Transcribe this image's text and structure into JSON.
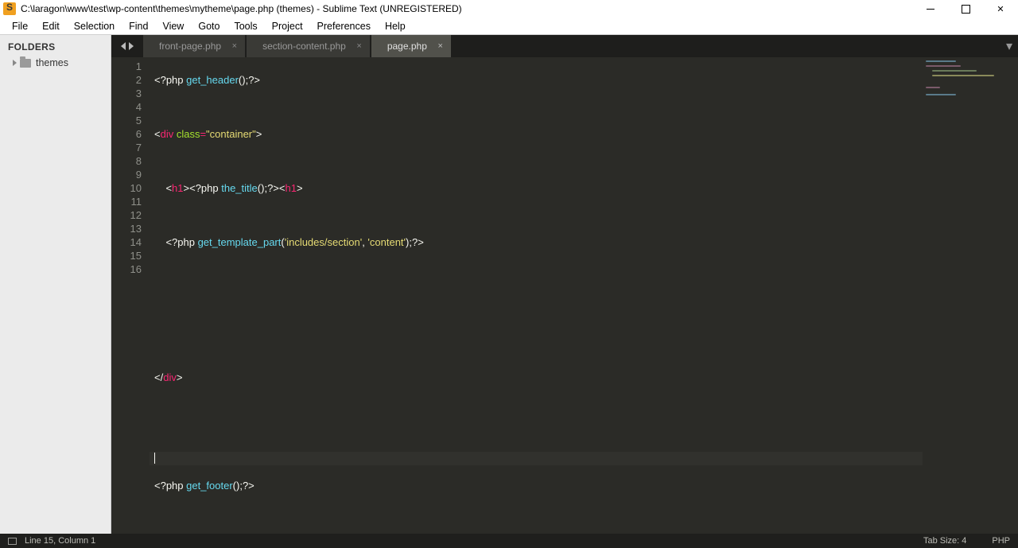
{
  "title": "C:\\laragon\\www\\test\\wp-content\\themes\\mytheme\\page.php (themes) - Sublime Text (UNREGISTERED)",
  "menu": [
    "File",
    "Edit",
    "Selection",
    "Find",
    "View",
    "Goto",
    "Tools",
    "Project",
    "Preferences",
    "Help"
  ],
  "sidebar": {
    "header": "FOLDERS",
    "item": "themes"
  },
  "tabs": [
    {
      "label": "front-page.php",
      "active": false
    },
    {
      "label": "section-content.php",
      "active": false
    },
    {
      "label": "page.php",
      "active": true
    }
  ],
  "lines": 16,
  "current_line": 15,
  "code": {
    "l1": {
      "open": "<?php ",
      "fn": "get_header",
      "rest": "();",
      "close": "?>"
    },
    "l3": {
      "lt": "<",
      "tag": "div ",
      "attr": "class",
      "eq": "=",
      "str": "\"container\"",
      "gt": ">"
    },
    "l5": {
      "indent": "    ",
      "lt1": "<",
      "tag1": "h1",
      "gt1": ">",
      "open": "<?php ",
      "fn": "the_title",
      "rest": "();",
      "close": "?>",
      "lt2": "<",
      "tag2": "h1",
      "gt2": ">"
    },
    "l7": {
      "indent": "    ",
      "open": "<?php ",
      "fn": "get_template_part",
      "paren": "(",
      "str1": "'includes/section'",
      "comma": ", ",
      "str2": "'content'",
      "rest": ");",
      "close": "?>"
    },
    "l12": {
      "lt": "</",
      "tag": "div",
      "gt": ">"
    },
    "l16": {
      "open": "<?php ",
      "fn": "get_footer",
      "rest": "();",
      "close": "?>"
    }
  },
  "status": {
    "pos": "Line 15, Column 1",
    "tab": "Tab Size: 4",
    "lang": "PHP"
  }
}
